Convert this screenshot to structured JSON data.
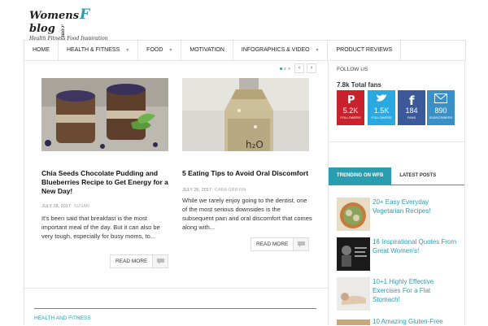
{
  "brand": {
    "name_left": "Womens",
    "name_f": "F",
    "name_right": "blog",
    "name_com": ".com",
    "tagline": "Health Fitness Food Inspiration"
  },
  "nav": {
    "items": [
      {
        "label": "HOME",
        "has_caret": false
      },
      {
        "label": "HEALTH & FITNESS",
        "has_caret": true
      },
      {
        "label": "FOOD",
        "has_caret": true
      },
      {
        "label": "MOTIVATION",
        "has_caret": false
      },
      {
        "label": "INFOGRAPHICS & VIDEO",
        "has_caret": true
      },
      {
        "label": "PRODUCT REVIEWS",
        "has_caret": false
      }
    ],
    "caret_glyph": "▼"
  },
  "slider": {
    "prev": "‹",
    "next": "›"
  },
  "posts": [
    {
      "title": "Chia Seeds Chocolate Pudding and Blueberries Recipe to Get Energy for a New Day!",
      "date": "JULY 28, 2017",
      "author": "SUSAN",
      "excerpt": "It's been said that breakfast is the most important meal of the day. But it can also be very tough, especially for busy moms, to...",
      "read_more": "READ MORE"
    },
    {
      "title": "5 Eating Tips to Avoid Oral Discomfort",
      "date": "JULY 26, 2017",
      "author": "CARA GRIFFIN",
      "excerpt": "While we rarely enjoy going to the dentist, one of the most serious downsides is the subsequent pain and oral discomfort that comes along with...",
      "read_more": "READ MORE"
    }
  ],
  "section": {
    "title": "HEALTH AND FITNESS"
  },
  "sidebar": {
    "follow_label": "FOLLOW US",
    "fans_total": "7.8k Total fans",
    "socials": [
      {
        "name": "pinterest",
        "count": "5.2K",
        "label": "FOLLOWERS",
        "color": "#c8232c"
      },
      {
        "name": "twitter",
        "count": "1.5K",
        "label": "FOLLOWERS",
        "color": "#2aa9e0"
      },
      {
        "name": "facebook",
        "count": "184",
        "label": "FANS",
        "color": "#3b5998"
      },
      {
        "name": "email",
        "count": "890",
        "label": "SUBSCRIBERS",
        "color": "#3a8fc7"
      }
    ],
    "tabs": [
      {
        "label": "TRENDING ON WFB",
        "active": true
      },
      {
        "label": "LATEST POSTS",
        "active": false
      }
    ],
    "trending": [
      {
        "title": "20+ Easy Everyday Vegetarian Recipes!"
      },
      {
        "title": "16 Inspirational Quotes From Great Women's!"
      },
      {
        "title": "10+1 Highly Effective Exercises For a Flat Stomach!"
      },
      {
        "title": "10 Amazing Gluten-Free"
      }
    ]
  },
  "colors": {
    "accent": "#2a9db0"
  }
}
